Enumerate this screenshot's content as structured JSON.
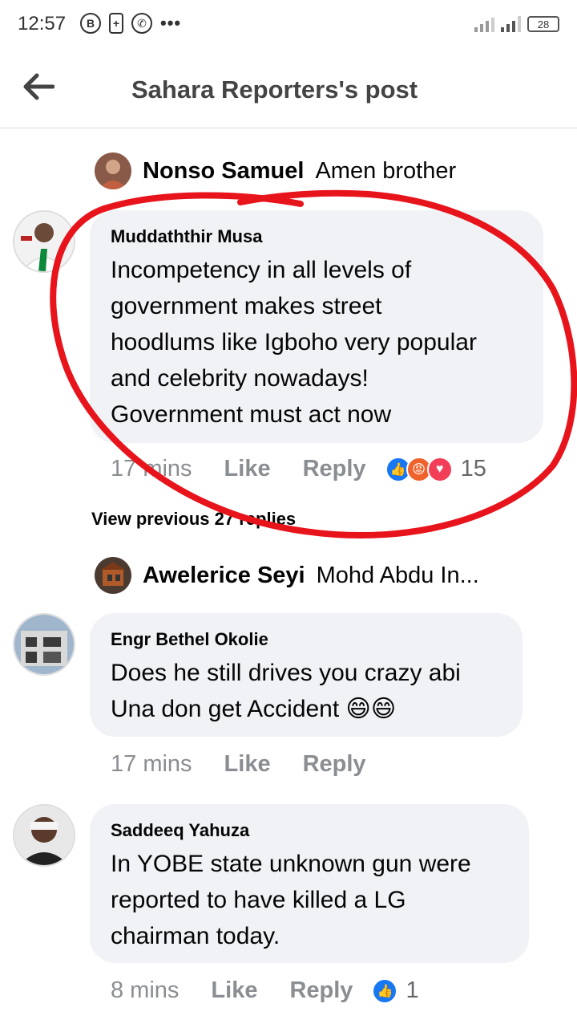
{
  "status": {
    "time": "12:57",
    "icons": [
      "b-circle-icon",
      "battery-saver-icon",
      "whatsapp-icon"
    ],
    "dots": "•••",
    "battery": "28"
  },
  "header": {
    "title": "Sahara Reporters's post"
  },
  "comments": [
    {
      "type": "collapsed",
      "name": "Nonso Samuel",
      "text": "Amen brother"
    },
    {
      "type": "full",
      "name": "Muddaththir Musa",
      "lines": [
        "Incompetency in all levels of",
        "government makes street",
        "hoodlums like Igboho very popular",
        "and celebrity nowadays!",
        "Government must act now"
      ],
      "time": "17 mins",
      "like": "Like",
      "reply": "Reply",
      "reactions": [
        "like",
        "angry",
        "love"
      ],
      "react_count": "15"
    },
    {
      "type": "view_previous",
      "text": "View previous 27 replies"
    },
    {
      "type": "collapsed",
      "name": "Awelerice Seyi",
      "text": "Mohd Abdu In..."
    },
    {
      "type": "full",
      "name": "Engr Bethel Okolie",
      "lines": [
        "Does he still drives you crazy abi",
        "Una don get Accident 😄😄"
      ],
      "time": "17 mins",
      "like": "Like",
      "reply": "Reply"
    },
    {
      "type": "full",
      "name": "Saddeeq Yahuza",
      "lines": [
        "In YOBE state unknown gun were",
        "reported to have killed a LG",
        "chairman today."
      ],
      "time": "8 mins",
      "like": "Like",
      "reply": "Reply",
      "reactions": [
        "like"
      ],
      "react_count": "1"
    }
  ],
  "colors": {
    "annotation_red": "#e8141c",
    "bubble_bg": "#f0f2f5",
    "meta_gray": "#8a8d91",
    "like_blue": "#1877f2"
  }
}
